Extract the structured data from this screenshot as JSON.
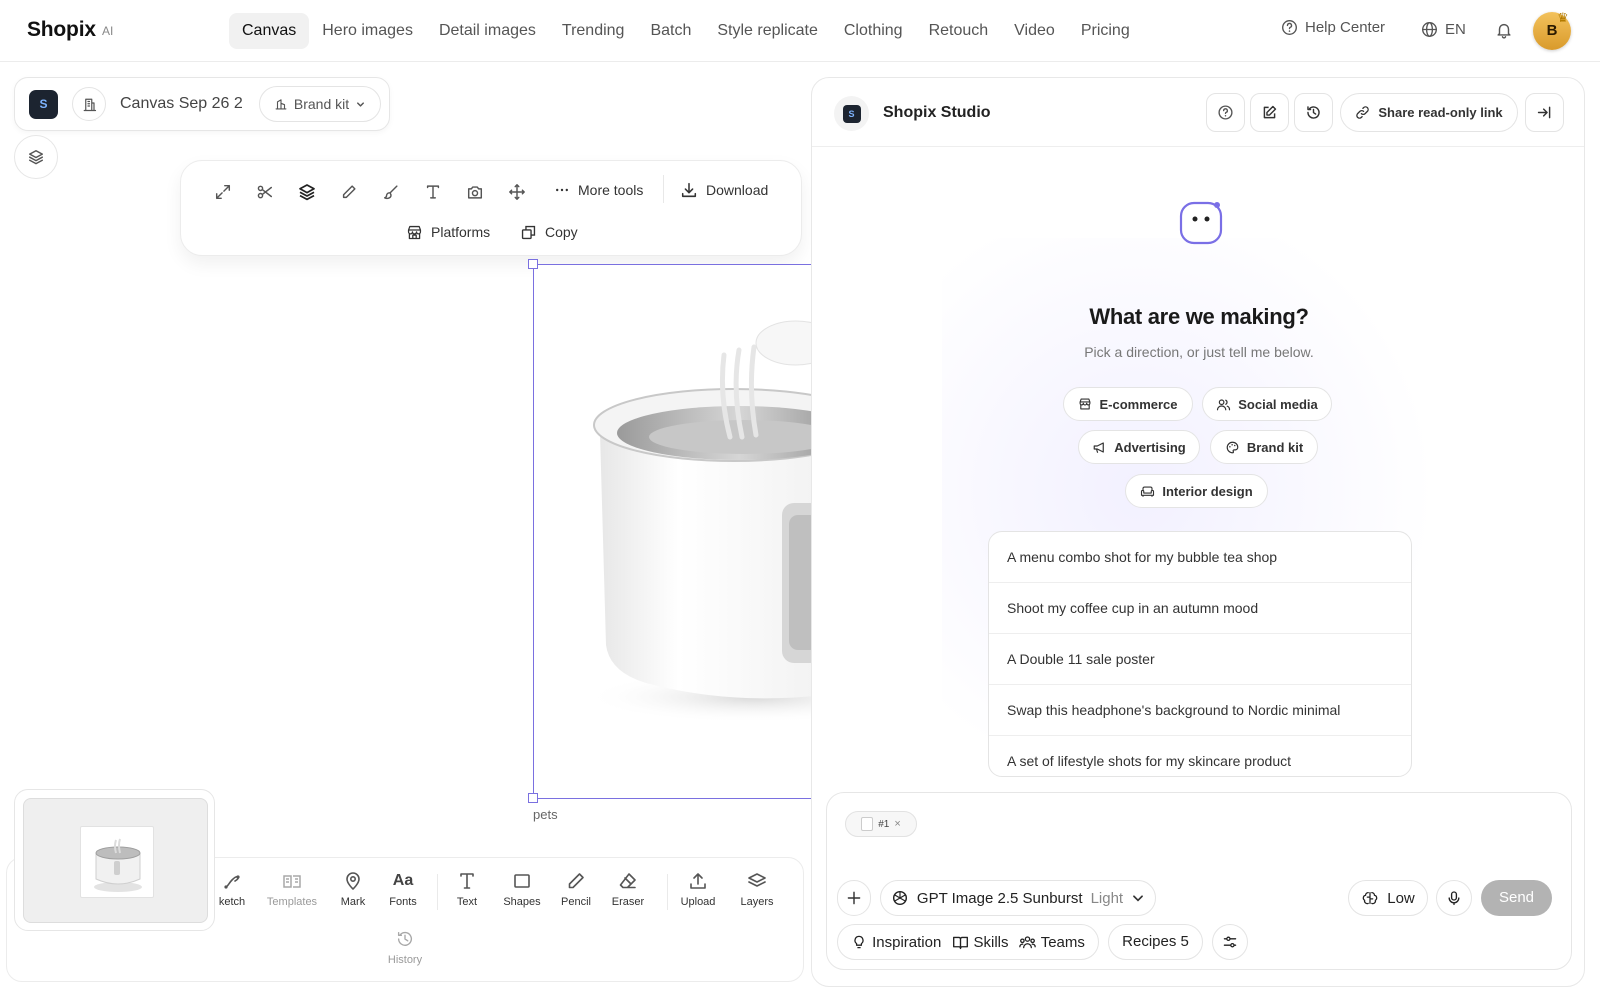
{
  "brand": {
    "name": "Shopix",
    "suffix": "AI"
  },
  "nav": {
    "tabs": [
      "Canvas",
      "Hero images",
      "Detail images",
      "Trending",
      "Batch",
      "Style replicate",
      "Clothing",
      "Retouch",
      "Video",
      "Pricing"
    ],
    "active": "Canvas",
    "help": "Help Center",
    "lang": "EN",
    "avatar_initial": "B"
  },
  "canvas": {
    "logo_letter": "S",
    "name": "Canvas Sep 26 2",
    "brand_kit": "Brand kit",
    "image_label": "pets"
  },
  "toolbar": {
    "more_tools": "More tools",
    "download": "Download",
    "platforms": "Platforms",
    "copy": "Copy",
    "icons": [
      "expand-icon",
      "scissors-icon",
      "layers-icon",
      "pencil-icon",
      "brush-icon",
      "text-icon",
      "camera-icon",
      "move-icon"
    ]
  },
  "bottom_tools": {
    "sketch": "ketch",
    "templates": "Templates",
    "mark": "Mark",
    "fonts": "Fonts",
    "text": "Text",
    "shapes": "Shapes",
    "pencil": "Pencil",
    "eraser": "Eraser",
    "upload": "Upload",
    "layers": "Layers",
    "history": "History",
    "fonts_glyph": "Aa"
  },
  "studio": {
    "logo_letter": "S",
    "title": "Shopix Studio",
    "share": "Share read-only link",
    "headline": "What are we making?",
    "subline": "Pick a direction, or just tell me below.",
    "chips": {
      "ecommerce": "E-commerce",
      "social": "Social media",
      "advertising": "Advertising",
      "brand_kit": "Brand kit",
      "interior": "Interior design"
    },
    "suggestions": [
      "A menu combo shot for my bubble tea shop",
      "Shoot my coffee cup in an autumn mood",
      "A Double 11 sale poster",
      "Swap this headphone's background to Nordic minimal",
      "A set of lifestyle shots for my skincare product"
    ]
  },
  "composer": {
    "attachment": "#1",
    "attachment_close": "×",
    "model": "GPT Image 2.5 Sunburst",
    "model_variant": "Light",
    "quality": "Low",
    "send": "Send",
    "inspiration": "Inspiration",
    "skills": "Skills",
    "teams": "Teams",
    "recipes": "Recipes 5"
  },
  "colors": {
    "accent": "#7a70e0",
    "send_disabled": "#b3b3b3",
    "avatar": "#e5ad3f"
  }
}
